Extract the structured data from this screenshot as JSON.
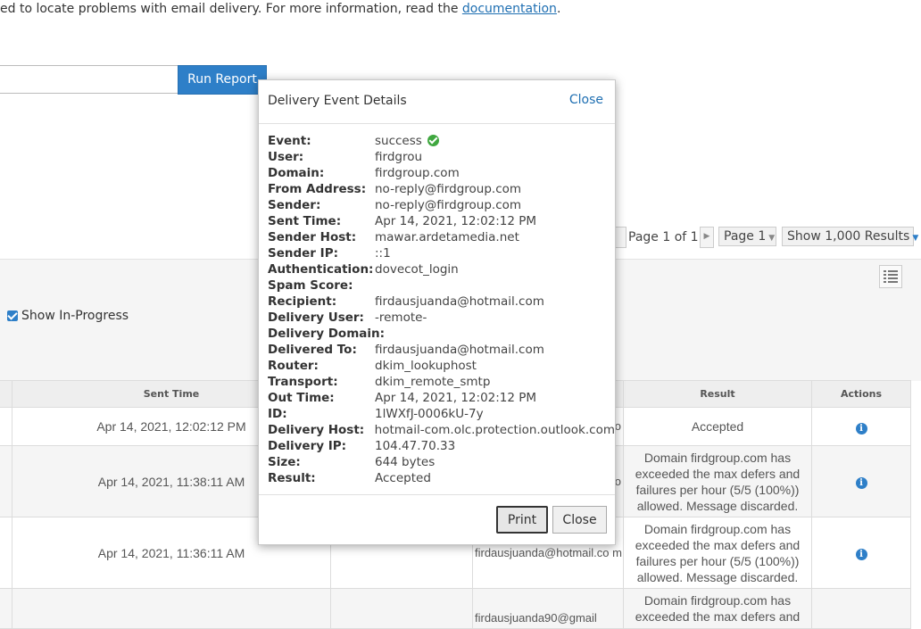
{
  "intro": {
    "text": "ed to locate problems with email delivery. For more information, read the ",
    "link": "documentation",
    "tail": "."
  },
  "toolbar": {
    "run_report": "Run Report"
  },
  "pagination": {
    "page_text": "Page 1 of 1",
    "page_select": "Page 1",
    "results_select": "Show 1,000 Results"
  },
  "filters": {
    "show_in_progress": "Show In-Progress",
    "show_in_progress_checked": true
  },
  "table": {
    "headers": {
      "sent_time": "Sent Time",
      "result": "Result",
      "actions": "Actions"
    },
    "rows": [
      {
        "sent_time": "Apr 14, 2021, 12:02:12 PM",
        "recipient_fragment": "o",
        "result": "Accepted"
      },
      {
        "sent_time": "Apr 14, 2021, 11:38:11 AM",
        "recipient_fragment": "o",
        "result": "Domain firdgroup.com has exceeded the max defers and failures per hour (5/5 (100%)) allowed. Message discarded."
      },
      {
        "sent_time": "Apr 14, 2021, 11:36:11 AM",
        "recipient_fragment": "firdausjuanda@hotmail.co m",
        "result": "Domain firdgroup.com has exceeded the max defers and failures per hour (5/5 (100%)) allowed. Message discarded."
      },
      {
        "sent_time": "",
        "recipient_fragment": "firdausjuanda90@gmail",
        "result": "Domain firdgroup.com has exceeded the max defers and"
      }
    ]
  },
  "modal": {
    "title": "Delivery Event Details",
    "close_link": "Close",
    "fields": [
      {
        "label": "Event:",
        "value": "success"
      },
      {
        "label": "User:",
        "value": "firdgrou"
      },
      {
        "label": "Domain:",
        "value": "firdgroup.com"
      },
      {
        "label": "From Address:",
        "value": "no-reply@firdgroup.com"
      },
      {
        "label": "Sender:",
        "value": "no-reply@firdgroup.com"
      },
      {
        "label": "Sent Time:",
        "value": "Apr 14, 2021, 12:02:12 PM"
      },
      {
        "label": "Sender Host:",
        "value": "mawar.ardetamedia.net"
      },
      {
        "label": "Sender IP:",
        "value": "::1"
      },
      {
        "label": "Authentication:",
        "value": "dovecot_login"
      },
      {
        "label": "Spam Score:",
        "value": ""
      },
      {
        "label": "Recipient:",
        "value": "firdausjuanda@hotmail.com"
      },
      {
        "label": "Delivery User:",
        "value": "-remote-"
      },
      {
        "label": "Delivery Domain:",
        "value": ""
      },
      {
        "label": "Delivered To:",
        "value": "firdausjuanda@hotmail.com"
      },
      {
        "label": "Router:",
        "value": "dkim_lookuphost"
      },
      {
        "label": "Transport:",
        "value": "dkim_remote_smtp"
      },
      {
        "label": "Out Time:",
        "value": "Apr 14, 2021, 12:02:12 PM"
      },
      {
        "label": "ID:",
        "value": "1lWXfJ-0006kU-7y"
      },
      {
        "label": "Delivery Host:",
        "value": "hotmail-com.olc.protection.outlook.com"
      },
      {
        "label": "Delivery IP:",
        "value": "104.47.70.33"
      },
      {
        "label": "Size:",
        "value": "644 bytes"
      },
      {
        "label": "Result:",
        "value": "Accepted"
      }
    ],
    "print_label": "Print",
    "close_label": "Close"
  },
  "icons": {
    "event_status": "check-circle-icon",
    "row_action": "info-circle-icon",
    "view_toggle": "list-view-icon"
  },
  "colors": {
    "accent": "#2e7fc8",
    "success": "#3fa73f"
  }
}
